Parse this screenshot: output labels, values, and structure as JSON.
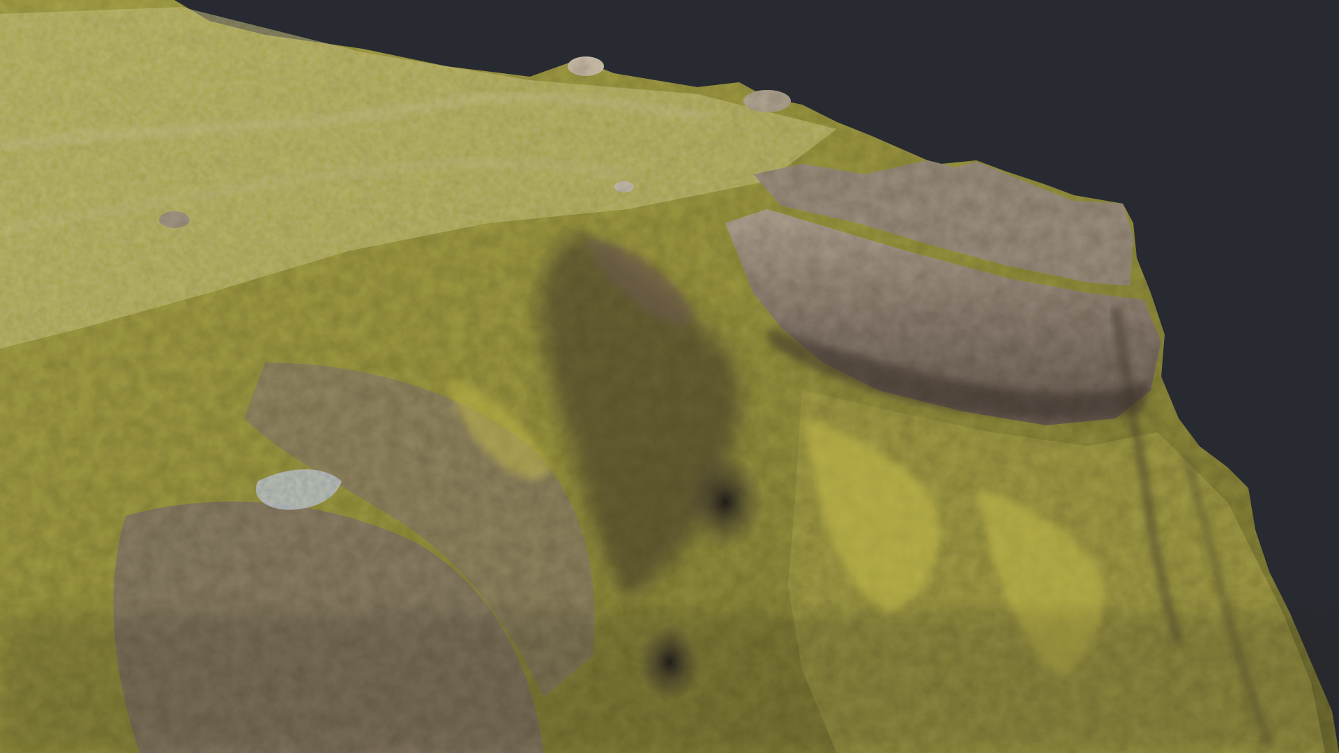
{
  "viewport": {
    "background_color": "#272a31"
  },
  "scene": {
    "subject": "photogrammetry-rock-cliff",
    "colors": {
      "moss_light": "#b6b04a",
      "moss_mid": "#9c9a3c",
      "moss_dark": "#6f6f2d",
      "rock_light": "#b7a796",
      "rock_mid": "#8f8072",
      "rock_dark": "#5c5149",
      "shadow": "#2f2a24",
      "highlight": "#d6cdbd",
      "grey_patch": "#9ca8b2"
    }
  }
}
